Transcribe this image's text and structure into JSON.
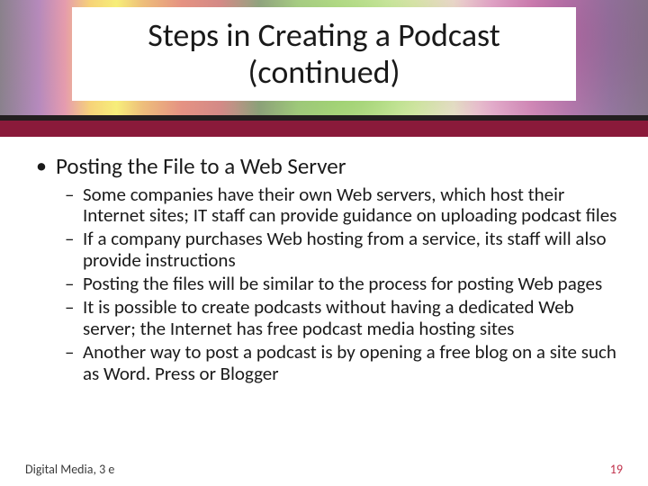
{
  "title": "Steps in Creating a Podcast (continued)",
  "bullet1": "Posting the File to a Web Server",
  "sub": [
    "Some companies have their own Web servers, which host their Internet sites; IT staff can provide guidance on uploading podcast files",
    "If a company purchases Web hosting from a service, its staff will also provide instructions",
    "Posting the files will be similar to the process for posting Web pages",
    "It is possible to create podcasts without having a dedicated Web server; the Internet has free podcast media hosting sites",
    "Another way to post a podcast is by opening a free blog on a site such as Word. Press or Blogger"
  ],
  "footer": {
    "source": "Digital Media, 3 e",
    "page": "19"
  },
  "colors": {
    "accent_bar": "#8a1a3a",
    "dark_bar": "#231f20",
    "page_num": "#c0304a"
  }
}
